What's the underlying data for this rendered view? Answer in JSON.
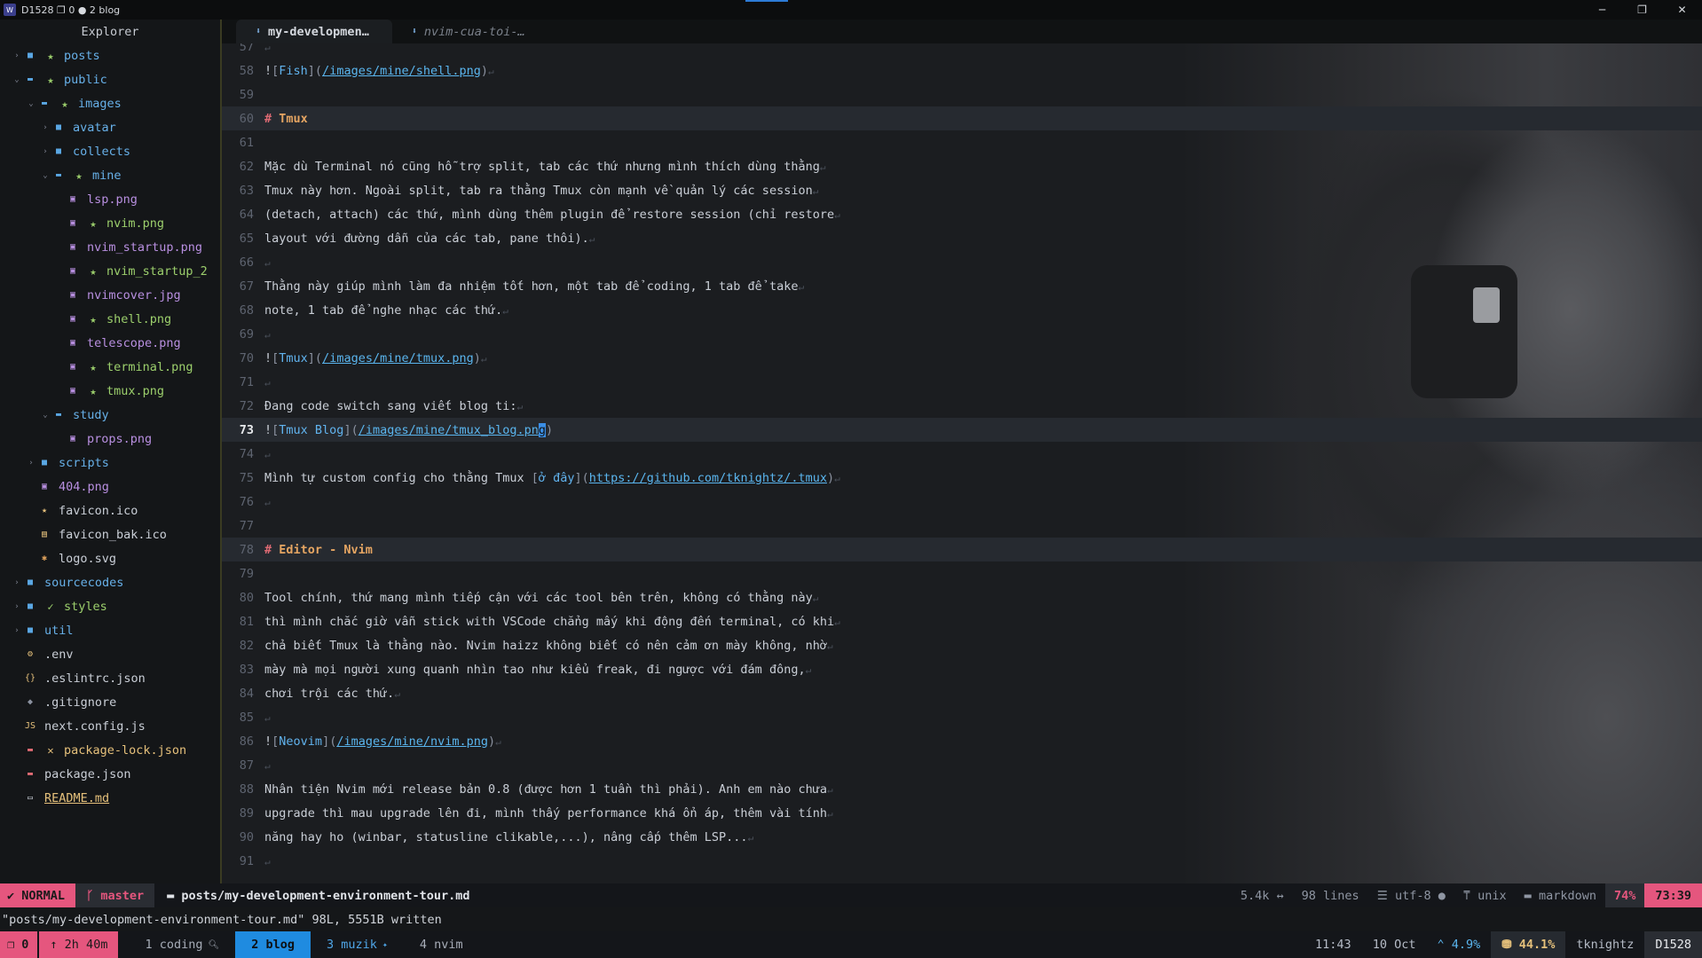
{
  "window": {
    "title": "D1528 ❐ 0 ● 2 blog",
    "badge": "W",
    "minimize": "─",
    "maximize": "❐",
    "close": "✕"
  },
  "explorer": {
    "title": "Explorer",
    "items": [
      {
        "name": "posts",
        "depth": 0,
        "arrow": "›",
        "icon": "■",
        "mark": "★",
        "cls": "c-dir",
        "icls": "c-dirico",
        "mcls": "c-git"
      },
      {
        "name": "public",
        "depth": 0,
        "arrow": "⌄",
        "icon": "▬",
        "mark": "★",
        "cls": "c-dir",
        "icls": "c-dirico",
        "mcls": "c-git"
      },
      {
        "name": "images",
        "depth": 1,
        "arrow": "⌄",
        "icon": "▬",
        "mark": "★",
        "cls": "c-dir",
        "icls": "c-dirico",
        "mcls": "c-git"
      },
      {
        "name": "avatar",
        "depth": 2,
        "arrow": "›",
        "icon": "■",
        "mark": "",
        "cls": "c-dir",
        "icls": "c-dirico",
        "mcls": ""
      },
      {
        "name": "collects",
        "depth": 2,
        "arrow": "›",
        "icon": "■",
        "mark": "",
        "cls": "c-dir",
        "icls": "c-dirico",
        "mcls": ""
      },
      {
        "name": "mine",
        "depth": 2,
        "arrow": "⌄",
        "icon": "▬",
        "mark": "★",
        "cls": "c-dir",
        "icls": "c-dirico",
        "mcls": "c-git"
      },
      {
        "name": "lsp.png",
        "depth": 3,
        "arrow": "",
        "icon": "▣",
        "mark": "",
        "cls": "c-purple",
        "icls": "c-purple",
        "mcls": ""
      },
      {
        "name": "nvim.png",
        "depth": 3,
        "arrow": "",
        "icon": "▣",
        "mark": "★",
        "cls": "c-git",
        "icls": "c-purple",
        "mcls": "c-git"
      },
      {
        "name": "nvim_startup.png",
        "depth": 3,
        "arrow": "",
        "icon": "▣",
        "mark": "",
        "cls": "c-purple",
        "icls": "c-purple",
        "mcls": ""
      },
      {
        "name": "nvim_startup_2",
        "depth": 3,
        "arrow": "",
        "icon": "▣",
        "mark": "★",
        "cls": "c-git",
        "icls": "c-purple",
        "mcls": "c-git"
      },
      {
        "name": "nvimcover.jpg",
        "depth": 3,
        "arrow": "",
        "icon": "▣",
        "mark": "",
        "cls": "c-purple",
        "icls": "c-purple",
        "mcls": ""
      },
      {
        "name": "shell.png",
        "depth": 3,
        "arrow": "",
        "icon": "▣",
        "mark": "★",
        "cls": "c-git",
        "icls": "c-purple",
        "mcls": "c-git"
      },
      {
        "name": "telescope.png",
        "depth": 3,
        "arrow": "",
        "icon": "▣",
        "mark": "",
        "cls": "c-purple",
        "icls": "c-purple",
        "mcls": ""
      },
      {
        "name": "terminal.png",
        "depth": 3,
        "arrow": "",
        "icon": "▣",
        "mark": "★",
        "cls": "c-git",
        "icls": "c-purple",
        "mcls": "c-git"
      },
      {
        "name": "tmux.png",
        "depth": 3,
        "arrow": "",
        "icon": "▣",
        "mark": "★",
        "cls": "c-git",
        "icls": "c-purple",
        "mcls": "c-git"
      },
      {
        "name": "study",
        "depth": 2,
        "arrow": "⌄",
        "icon": "▬",
        "mark": "",
        "cls": "c-dir",
        "icls": "c-dirico",
        "mcls": ""
      },
      {
        "name": "props.png",
        "depth": 3,
        "arrow": "",
        "icon": "▣",
        "mark": "",
        "cls": "c-purple",
        "icls": "c-purple",
        "mcls": ""
      },
      {
        "name": "scripts",
        "depth": 1,
        "arrow": "›",
        "icon": "■",
        "mark": "",
        "cls": "c-dir",
        "icls": "c-dirico",
        "mcls": ""
      },
      {
        "name": "404.png",
        "depth": 1,
        "arrow": "",
        "icon": "▣",
        "mark": "",
        "cls": "c-purple",
        "icls": "c-purple",
        "mcls": ""
      },
      {
        "name": "favicon.ico",
        "depth": 1,
        "arrow": "",
        "icon": "★",
        "mark": "",
        "cls": "c-file",
        "icls": "c-yellow",
        "mcls": ""
      },
      {
        "name": "favicon_bak.ico",
        "depth": 1,
        "arrow": "",
        "icon": "▤",
        "mark": "",
        "cls": "c-file",
        "icls": "c-yellow",
        "mcls": ""
      },
      {
        "name": "logo.svg",
        "depth": 1,
        "arrow": "",
        "icon": "✱",
        "mark": "",
        "cls": "c-file",
        "icls": "c-orange",
        "mcls": ""
      },
      {
        "name": "sourcecodes",
        "depth": 0,
        "arrow": "›",
        "icon": "■",
        "mark": "",
        "cls": "c-dir",
        "icls": "c-dirico",
        "mcls": ""
      },
      {
        "name": "styles",
        "depth": 0,
        "arrow": "›",
        "icon": "■",
        "mark": "✓",
        "cls": "c-git",
        "icls": "c-dirico",
        "mcls": "c-git"
      },
      {
        "name": "util",
        "depth": 0,
        "arrow": "›",
        "icon": "■",
        "mark": "",
        "cls": "c-dir",
        "icls": "c-dirico",
        "mcls": ""
      },
      {
        "name": ".env",
        "depth": 0,
        "arrow": "",
        "icon": "⚙",
        "mark": "",
        "cls": "c-file",
        "icls": "c-yellow",
        "mcls": ""
      },
      {
        "name": ".eslintrc.json",
        "depth": 0,
        "arrow": "",
        "icon": "{}",
        "mark": "",
        "cls": "c-file",
        "icls": "c-yellow",
        "mcls": ""
      },
      {
        "name": ".gitignore",
        "depth": 0,
        "arrow": "",
        "icon": "◆",
        "mark": "",
        "cls": "c-file",
        "icls": "c-gray",
        "mcls": ""
      },
      {
        "name": "next.config.js",
        "depth": 0,
        "arrow": "",
        "icon": "JS",
        "mark": "",
        "cls": "c-file",
        "icls": "c-yellow",
        "mcls": ""
      },
      {
        "name": "package-lock.json",
        "depth": 0,
        "arrow": "",
        "icon": "▬",
        "mark": "✕",
        "cls": "c-yellow",
        "icls": "c-red",
        "mcls": "c-yellow"
      },
      {
        "name": "package.json",
        "depth": 0,
        "arrow": "",
        "icon": "▬",
        "mark": "",
        "cls": "c-file",
        "icls": "c-red",
        "mcls": ""
      },
      {
        "name": "README.md",
        "depth": 0,
        "arrow": "",
        "icon": "▭",
        "mark": "",
        "cls": "c-yellow",
        "icls": "c-file",
        "mcls": ""
      }
    ]
  },
  "tabs": [
    {
      "label": "my-developmen…",
      "pin": "⬇",
      "active": true
    },
    {
      "label": "nvim-cua-toi-…",
      "pin": "⬇",
      "active": false
    }
  ],
  "editor": {
    "eol": "↵",
    "lines": [
      {
        "n": "57",
        "type": "empty"
      },
      {
        "n": "58",
        "type": "img",
        "alt": "Fish",
        "url": "/images/mine/shell.png"
      },
      {
        "n": "59",
        "type": "blank"
      },
      {
        "n": "60",
        "type": "heading",
        "text": "Tmux"
      },
      {
        "n": "61",
        "type": "blank"
      },
      {
        "n": "62",
        "type": "text",
        "text": "Mặc dù Terminal nó cũng hỗ trợ split, tab các thứ nhưng mình thích dùng thằng"
      },
      {
        "n": "63",
        "type": "text",
        "text": "Tmux này hơn. Ngoài split, tab ra thằng Tmux còn mạnh về quản lý các session"
      },
      {
        "n": "64",
        "type": "text",
        "text": "(detach, attach) các thứ, mình dùng thêm plugin để restore session (chỉ restore"
      },
      {
        "n": "65",
        "type": "text",
        "text": "layout với đường dẫn của các tab, pane thôi)."
      },
      {
        "n": "66",
        "type": "empty"
      },
      {
        "n": "67",
        "type": "text",
        "text": "Thằng này giúp mình làm đa nhiệm tốt hơn, một tab để coding, 1 tab để take"
      },
      {
        "n": "68",
        "type": "text",
        "text": "note, 1 tab để nghe nhạc các thứ."
      },
      {
        "n": "69",
        "type": "empty"
      },
      {
        "n": "70",
        "type": "img",
        "alt": "Tmux",
        "url": "/images/mine/tmux.png"
      },
      {
        "n": "71",
        "type": "empty"
      },
      {
        "n": "72",
        "type": "text",
        "text": "Đang code switch sang viết blog ti:"
      },
      {
        "n": "73",
        "type": "imgcursor",
        "alt": "Tmux Blog",
        "url": "/images/mine/tmux_blog.pn",
        "cursorchar": "g"
      },
      {
        "n": "74",
        "type": "empty"
      },
      {
        "n": "75",
        "type": "linkline",
        "text": "Mình tự custom config cho thằng Tmux ",
        "alt": "ở đây",
        "url": "https://github.com/tknightz/.tmux"
      },
      {
        "n": "76",
        "type": "empty"
      },
      {
        "n": "77",
        "type": "blank"
      },
      {
        "n": "78",
        "type": "heading",
        "text": "Editor - Nvim"
      },
      {
        "n": "79",
        "type": "blank"
      },
      {
        "n": "80",
        "type": "text",
        "text": "Tool chính, thứ mang mình tiếp cận với các tool bên trên, không có thằng này"
      },
      {
        "n": "81",
        "type": "text",
        "text": "thì mình chắc giờ vẫn stick with VSCode chẳng mấy khi động đến terminal, có khi"
      },
      {
        "n": "82",
        "type": "text",
        "text": "chả biết Tmux là thằng nào. Nvim haizz không biết có nên cảm ơn mày không, nhờ"
      },
      {
        "n": "83",
        "type": "text",
        "text": "mày mà mọi người xung quanh nhìn tao như kiểu freak, đi ngược với đám đông,"
      },
      {
        "n": "84",
        "type": "text",
        "text": "chơi trội các thứ."
      },
      {
        "n": "85",
        "type": "empty"
      },
      {
        "n": "86",
        "type": "img",
        "alt": "Neovim",
        "url": "/images/mine/nvim.png"
      },
      {
        "n": "87",
        "type": "empty"
      },
      {
        "n": "88",
        "type": "text",
        "text": "Nhân tiện Nvim mới release bản 0.8 (được hơn 1 tuần thì phải). Anh em nào chưa"
      },
      {
        "n": "89",
        "type": "text",
        "text": "upgrade thì mau upgrade lên đi, mình thấy performance khá ổn áp, thêm vài tính"
      },
      {
        "n": "90",
        "type": "text",
        "text": "năng hay ho (winbar, statusline clikable,...), nâng cấp thêm LSP..."
      },
      {
        "n": "91",
        "type": "empty"
      }
    ]
  },
  "statusline": {
    "mode_icon": "✔",
    "mode": "NORMAL",
    "branch_icon": "ᚴ",
    "branch": "master",
    "file_icon": "▬",
    "file": "posts/my-development-environment-tour.md",
    "size": "5.4k",
    "size_sep": "↔",
    "lines": "98 lines",
    "enc_icon": "☰",
    "encoding": "utf-8",
    "dot": "●",
    "ff_icon": "⍑",
    "fileformat": "unix",
    "ft_icon": "▬",
    "filetype": "markdown",
    "percent": "74%",
    "position": "73:39"
  },
  "cmdline": {
    "text": "\"posts/my-development-environment-tour.md\" 98L, 5551B written"
  },
  "tmux": {
    "session_icon": "❐",
    "session": "0",
    "uptime": "↑ 2h 40m",
    "windows": [
      {
        "label": "1 coding",
        "suffix": "🔍︎",
        "active": false,
        "bell": false
      },
      {
        "label": "2 blog",
        "suffix": "",
        "active": true,
        "bell": false
      },
      {
        "label": "3 muzik",
        "suffix": "✦",
        "active": false,
        "bell": true
      },
      {
        "label": "4 nvim",
        "suffix": "",
        "active": false,
        "bell": false
      }
    ],
    "time": "11:43",
    "date": "10 Oct",
    "cpu": "⌃ 4.9%",
    "mem": "⛃ 44.1%",
    "user": "tknightz",
    "host": "D1528"
  }
}
